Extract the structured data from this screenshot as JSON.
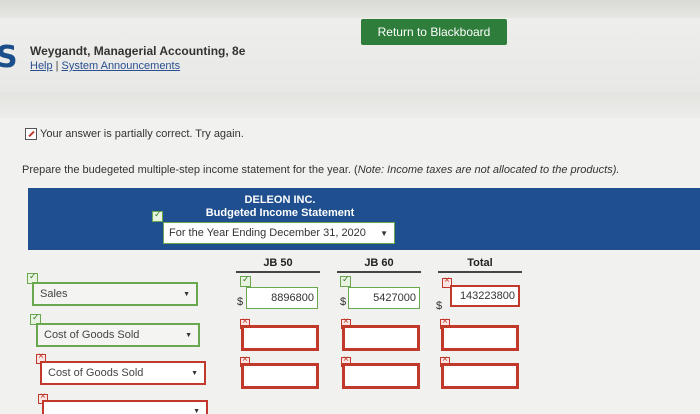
{
  "header": {
    "return_label": "Return to Blackboard",
    "logo_letter": "S",
    "course_title": "Weygandt, Managerial Accounting, 8e",
    "links": [
      "Help",
      "System Announcements"
    ],
    "link_separator": "|"
  },
  "status": {
    "message": "Your answer is partially correct.  Try again."
  },
  "instructions": {
    "prefix": "Prepare the budegeted multiple-step income statement for the year. (",
    "note": "Note:",
    "suffix": " Income taxes are not allocated to the products)."
  },
  "statement": {
    "company": "DELEON INC.",
    "title": "Budgeted Income Statement",
    "period": "For the Year Ending December 31, 2020"
  },
  "columns": [
    "JB 50",
    "JB 60",
    "Total"
  ],
  "rows": [
    {
      "label": "Sales",
      "status": "correct",
      "values": [
        "8896800",
        "5427000",
        "143223800"
      ],
      "dollar_sign": "$"
    },
    {
      "label": "Cost of Goods Sold",
      "status": "correct",
      "values": [
        "",
        "",
        ""
      ]
    },
    {
      "label": "Cost of Goods Sold",
      "status": "incorrect",
      "values": [
        "",
        "",
        ""
      ]
    },
    {
      "label": "",
      "status": "incorrect",
      "values": []
    }
  ],
  "colors": {
    "accent_blue": "#1f4f8e",
    "button_green": "#2e7d3a",
    "correct": "#6aa84f",
    "incorrect": "#c0392b"
  }
}
